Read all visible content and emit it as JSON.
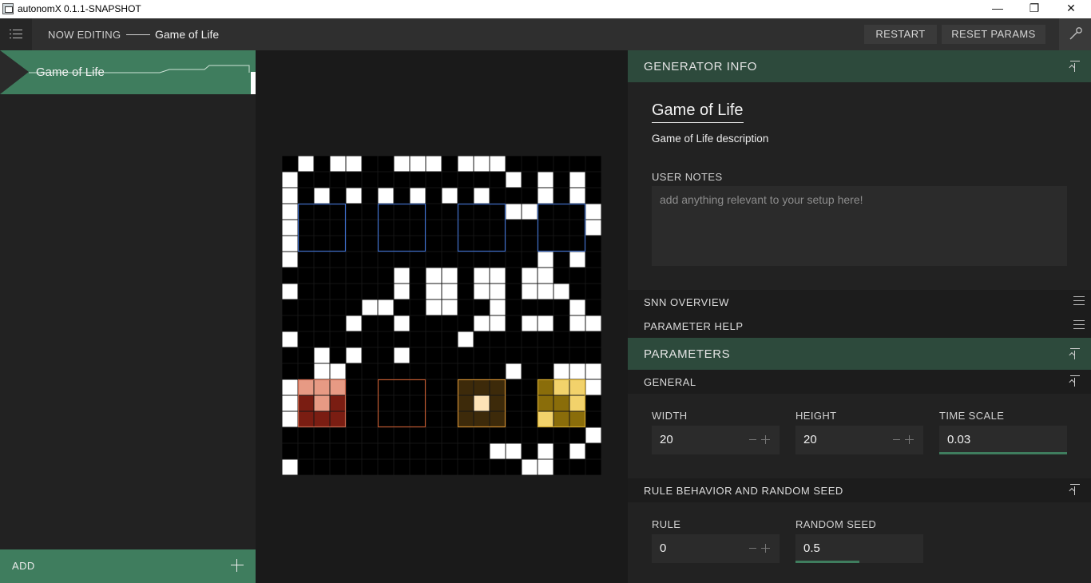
{
  "window": {
    "title": "autonomX 0.1.1-SNAPSHOT",
    "minimize_glyph": "—",
    "restore_glyph": "❐",
    "close_glyph": "✕"
  },
  "topbar": {
    "now_editing_label": "NOW EDITING",
    "current_generator": "Game of Life",
    "restart_label": "RESTART",
    "reset_params_label": "RESET PARAMS"
  },
  "sidebar": {
    "items": [
      {
        "label": "Game of Life",
        "selected": true
      }
    ],
    "add_label": "ADD"
  },
  "lattice": {
    "rows": [
      "01011001110111000000",
      "10000000000000101010",
      "10101010101010001010",
      "10000000000000110001",
      "10000000000000000001",
      "10000000000000000000",
      "10000000000000001010",
      "00000001011011011000",
      "10000001011011011100",
      "00000110011001000010",
      "00001001000011011011",
      "10000000000100000000",
      "00101001000000000000",
      "00110000000000100111",
      "10000000000000000001",
      "10000000000000000000",
      "10000000000000000000",
      "00000000000000000001",
      "00000000000001101010",
      "10000000000000011000"
    ],
    "input_regions": [
      {
        "row": 3,
        "col": 1,
        "size": 3,
        "color": "#3c6bc4"
      },
      {
        "row": 3,
        "col": 6,
        "size": 3,
        "color": "#3c6bc4"
      },
      {
        "row": 3,
        "col": 11,
        "size": 3,
        "color": "#3c6bc4"
      },
      {
        "row": 3,
        "col": 16,
        "size": 3,
        "color": "#3c6bc4"
      }
    ],
    "output_regions": [
      {
        "row": 14,
        "col": 1,
        "size": 3,
        "border": "#c0634a",
        "fill": "#7a1d12",
        "active": "#e79a84",
        "pattern": "111010000"
      },
      {
        "row": 14,
        "col": 6,
        "size": 3,
        "border": "#b8552e",
        "fill": "#000000",
        "active": "#000000",
        "pattern": "000000000"
      },
      {
        "row": 14,
        "col": 11,
        "size": 3,
        "border": "#c8872e",
        "fill": "#3d2a0a",
        "active": "#fde3b7",
        "pattern": "000010000"
      },
      {
        "row": 14,
        "col": 16,
        "size": 3,
        "border": "#cfa52a",
        "fill": "#8a6d0a",
        "active": "#f2d26b",
        "pattern": "011001100"
      }
    ],
    "colors": {
      "alive": "#ffffff",
      "dead": "#000000",
      "gridline": "#151515"
    }
  },
  "generator_info": {
    "header": "GENERATOR INFO",
    "name": "Game of Life",
    "description": "Game of Life description",
    "user_notes_label": "USER NOTES",
    "user_notes_placeholder": "add anything relevant to your setup here!"
  },
  "snn_overview": {
    "header": "SNN OVERVIEW"
  },
  "parameter_help": {
    "header": "PARAMETER HELP"
  },
  "parameters": {
    "header": "PARAMETERS",
    "general": {
      "header": "GENERAL",
      "width_label": "WIDTH",
      "width_value": "20",
      "height_label": "HEIGHT",
      "height_value": "20",
      "time_scale_label": "TIME SCALE",
      "time_scale_value": "0.03",
      "time_scale_level": 1.0
    },
    "rule_behavior": {
      "header": "RULE BEHAVIOR AND RANDOM SEED",
      "rule_label": "RULE",
      "rule_value": "0",
      "random_seed_label": "RANDOM SEED",
      "random_seed_value": "0.5",
      "random_seed_level": 0.5
    }
  },
  "colors": {
    "accent": "#3f7d5e",
    "header_bg": "#2d4a3c",
    "panel_bg": "#222222"
  }
}
